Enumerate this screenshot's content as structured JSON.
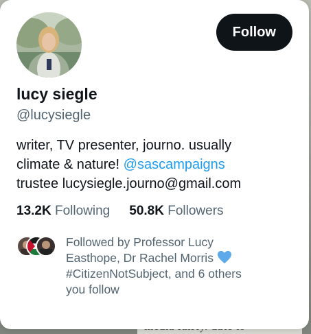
{
  "profile": {
    "name": "lucy siegle",
    "handle": "@lucysiegle",
    "bio_line1": "writer, TV presenter, journo. usually",
    "bio_line2": "climate & nature!",
    "bio_mention": "@sascampaigns",
    "bio_line3": "trustee lucysiegle.journo@gmail.com",
    "avatar_icon": "profile-photo"
  },
  "follow_button": {
    "label": "Follow"
  },
  "stats": {
    "following_count": "13.2K",
    "following_label": "Following",
    "followers_count": "50.8K",
    "followers_label": "Followers"
  },
  "followed_by": {
    "text_before_heart": "Followed by Professor Lucy Easthope, Dr Rachel Morris",
    "heart_icon": "blue-heart-icon",
    "text_after_heart": "#CitizenNotSubject, and 6 others you follow"
  },
  "background": {
    "partial_text": "media fairly. date to",
    "color_page": "#9aa095"
  },
  "colors": {
    "accent": "#1d9bf0",
    "button_bg": "#0f1419",
    "secondary_text": "#536471"
  }
}
